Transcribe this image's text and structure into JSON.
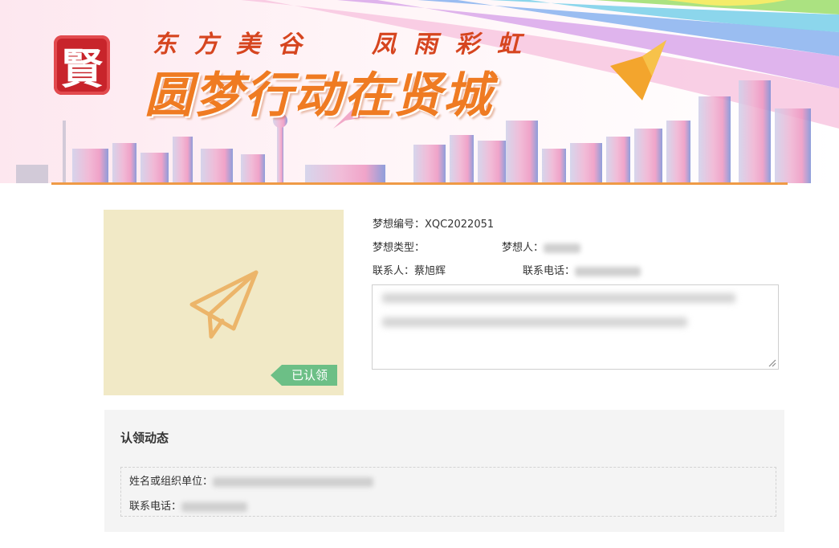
{
  "banner": {
    "seal_char": "賢",
    "subtitle": "东方美谷  凤雨彩虹",
    "title": "圆梦行动在贤城"
  },
  "dream": {
    "status_tag": "已认领",
    "id_label": "梦想编号：",
    "id_value": "XQC2022051",
    "type_label": "梦想类型：",
    "type_value": "",
    "dreamer_label": "梦想人：",
    "contact_label": "联系人：",
    "contact_value": "蔡旭辉",
    "phone_label": "联系电话："
  },
  "claim": {
    "title": "认领动态",
    "name_label": "姓名或组织单位：",
    "phone_label": "联系电话："
  },
  "colors": {
    "accent_orange": "#ef9a46",
    "tag_green": "#6cbf86",
    "thumb_bg": "#f1e9c6",
    "panel_bg": "#f4f4f4"
  },
  "icons": {
    "thumb": "paper-plane-icon",
    "logo": "seal-logo"
  }
}
